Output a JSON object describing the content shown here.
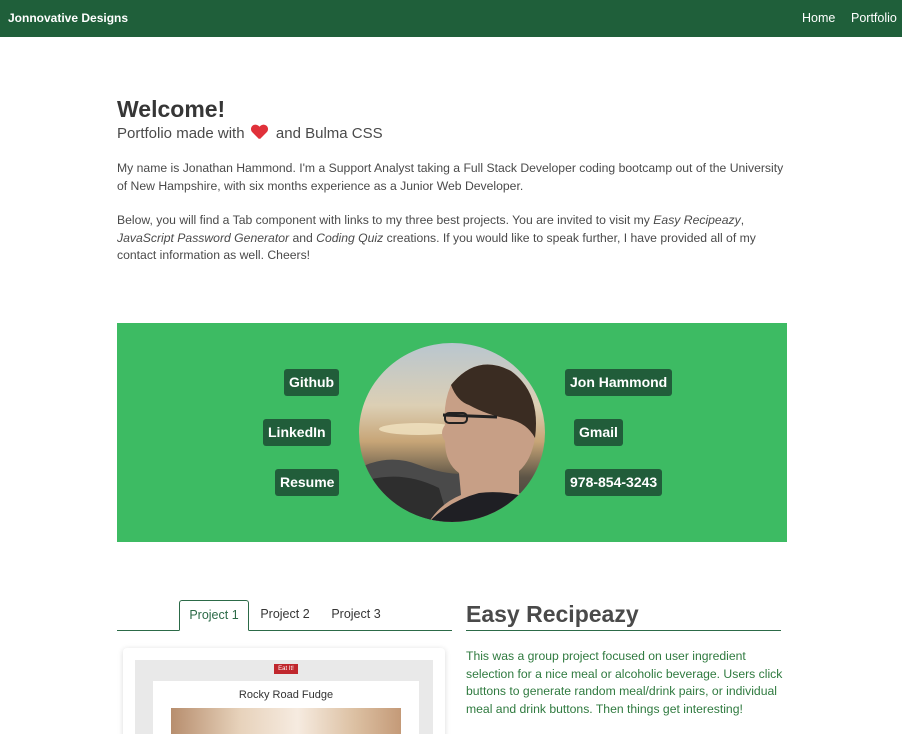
{
  "navbar": {
    "brand": "Jonnovative Designs",
    "links": [
      "Home",
      "Portfolio"
    ]
  },
  "hero": {
    "title": "Welcome!",
    "subtitle_before": "Portfolio made with",
    "subtitle_after": "and Bulma CSS",
    "heart_icon": "heart-icon"
  },
  "intro": {
    "paragraph1": "My name is Jonathan Hammond. I'm a Support Analyst taking a Full Stack Developer coding bootcamp out of the University of New Hampshire, with six months experience as a Junior Web Developer.",
    "p2_a": "Below, you will find a Tab component with links to my three best projects. You are invited to visit my ",
    "p2_em1": "Easy Recipeazy",
    "p2_b": ", ",
    "p2_em2": "JavaScript Password Generator",
    "p2_c": " and ",
    "p2_em3": "Coding Quiz",
    "p2_d": " creations. If you would like to speak further, I have provided all of my contact information as well. Cheers!"
  },
  "contact": {
    "band_color": "#3dbb63",
    "button_color": "#215d3a",
    "github": "Github",
    "linkedin": "LinkedIn",
    "resume": "Resume",
    "name": "Jon Hammond",
    "gmail": "Gmail",
    "phone": "978-854-3243"
  },
  "tabs": [
    "Project 1",
    "Project 2",
    "Project 3"
  ],
  "project": {
    "title": "Easy Recipeazy",
    "description": "This was a group project focused on user ingredient selection for a nice meal or alcoholic beverage. Users click buttons to generate random meal/drink pairs, or individual meal and drink buttons. Then things get interesting!",
    "preview": {
      "badge": "Eat It!",
      "title": "Rocky Road Fudge"
    }
  }
}
